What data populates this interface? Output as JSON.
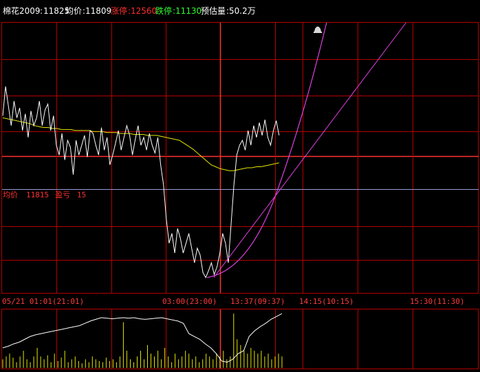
{
  "header": {
    "symbol_label": "棉花2009",
    "symbol_value": "11825",
    "avg_label": "均价",
    "avg_value": "11809",
    "limit_up_label": "涨停",
    "limit_up_value": "12560",
    "limit_down_label": "跌停",
    "limit_down_value": "11130",
    "est_vol_label": "预估量",
    "est_vol_value": "50.2万"
  },
  "overlay": {
    "avg_label": "均价",
    "avg_value": "11815",
    "extra_label": "盈亏",
    "extra_value": "15"
  },
  "colors": {
    "background": "#000000",
    "grid": "#b40000",
    "axis_text": "#ff3c3c",
    "price": "#ffffff",
    "avg": "#e6e600",
    "trend": "#e040e0",
    "volume": "#e6e600",
    "text_white": "#ffffff",
    "text_red": "#ff3030",
    "text_green": "#30ff30"
  },
  "chart_data": {
    "type": "line",
    "x_ticks": [
      "05/21 01:01(21:01)",
      "03:00(23:00)",
      "13:37(09:37)",
      "14:15(10:15)",
      "15:30(11:30)"
    ],
    "ylim": [
      11650,
      11925
    ],
    "reference_price": 11815,
    "series": [
      {
        "values": [
          11830,
          11860,
          11840,
          11820,
          11845,
          11828,
          11838,
          11815,
          11832,
          11808,
          11835,
          11820,
          11828,
          11845,
          11820,
          11836,
          11842,
          11815,
          11830,
          11800,
          11790,
          11812,
          11785,
          11805,
          11798,
          11770,
          11805,
          11790,
          11800,
          11810,
          11788,
          11815,
          11812,
          11800,
          11790,
          11818,
          11795,
          11808,
          11780,
          11790,
          11802,
          11815,
          11795,
          11808,
          11820,
          11810,
          11790,
          11806,
          11820,
          11800,
          11808,
          11795,
          11812,
          11800,
          11792,
          11808,
          11780,
          11760,
          11725,
          11700,
          11710,
          11690,
          11715,
          11705,
          11690,
          11700,
          11710,
          11695,
          11680,
          11695,
          11688,
          11670,
          11665,
          11672,
          11680,
          11668,
          11676,
          11690,
          11710,
          11700,
          11680,
          11720,
          11760,
          11790,
          11800,
          11805,
          11795,
          11815,
          11800,
          11820,
          11808,
          11823,
          11810,
          11826,
          11808,
          11800,
          11815,
          11825,
          11810
        ]
      },
      {
        "values": [
          11828,
          11827,
          11826,
          11825,
          11824,
          11823,
          11822,
          11820,
          11819,
          11818,
          11818,
          11817,
          11817,
          11816,
          11816,
          11816,
          11815,
          11815,
          11815,
          11815,
          11814,
          11814,
          11814,
          11813,
          11813,
          11813,
          11812,
          11812,
          11812,
          11811,
          11811,
          11811,
          11810,
          11810,
          11810,
          11809,
          11808,
          11807,
          11806,
          11805,
          11802,
          11799,
          11796,
          11792,
          11788,
          11784,
          11780,
          11778,
          11776,
          11775,
          11774,
          11774,
          11775,
          11776,
          11777,
          11777,
          11778,
          11778,
          11779,
          11780,
          11781,
          11782
        ]
      }
    ],
    "trend_lines": [
      {
        "from": [
          0.66,
          11665
        ],
        "to": [
          1.94,
          11925
        ],
        "type": "straight"
      },
      {
        "from": [
          0.57,
          11665
        ],
        "to": [
          1.55,
          11925
        ],
        "type": "curve"
      }
    ],
    "volume": {
      "line_values": [
        0.35,
        0.38,
        0.42,
        0.45,
        0.5,
        0.55,
        0.58,
        0.6,
        0.62,
        0.64,
        0.66,
        0.68,
        0.7,
        0.72,
        0.74,
        0.78,
        0.82,
        0.85,
        0.88,
        0.87,
        0.86,
        0.87,
        0.88,
        0.87,
        0.88,
        0.86,
        0.85,
        0.86,
        0.87,
        0.88,
        0.86,
        0.84,
        0.82,
        0.78,
        0.6,
        0.55,
        0.5,
        0.42,
        0.35,
        0.25,
        0.12,
        0.1,
        0.15,
        0.25,
        0.3,
        0.55,
        0.65,
        0.72,
        0.78,
        0.85,
        0.9,
        0.95
      ],
      "bar_values": [
        0.15,
        0.2,
        0.25,
        0.18,
        0.1,
        0.2,
        0.3,
        0.15,
        0.1,
        0.2,
        0.35,
        0.2,
        0.15,
        0.22,
        0.1,
        0.25,
        0.12,
        0.18,
        0.3,
        0.1,
        0.15,
        0.2,
        0.12,
        0.08,
        0.15,
        0.1,
        0.2,
        0.15,
        0.12,
        0.1,
        0.18,
        0.12,
        0.15,
        0.1,
        0.2,
        0.8,
        0.3,
        0.15,
        0.1,
        0.2,
        0.3,
        0.15,
        0.4,
        0.25,
        0.2,
        0.3,
        0.15,
        0.35,
        0.2,
        0.1,
        0.25,
        0.15,
        0.2,
        0.3,
        0.25,
        0.15,
        0.2,
        0.1,
        0.15,
        0.25,
        0.2,
        0.15,
        0.25,
        0.2,
        0.3,
        0.15,
        0.2,
        0.95,
        0.5,
        0.4,
        0.3,
        0.25,
        0.35,
        0.3,
        0.25,
        0.3,
        0.2,
        0.25,
        0.15,
        0.2,
        0.25,
        0.2
      ]
    }
  }
}
